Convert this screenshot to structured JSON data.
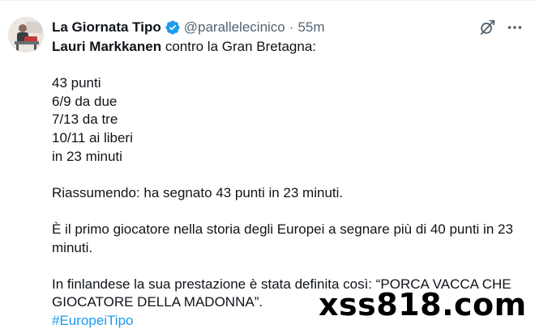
{
  "tweet": {
    "author_name": "La Giornata Tipo",
    "handle": "@parallelecinico",
    "separator": "·",
    "time": "55m",
    "verified_color": "#1d9bf0",
    "actions": [
      "grok-icon",
      "more-icon"
    ],
    "line1_bold": "Lauri Markkanen",
    "line1_rest": " contro la Gran Bretagna:",
    "stats": [
      "43 punti",
      "6/9 da due",
      "7/13 da tre",
      "10/11 ai liberi",
      "in 23 minuti"
    ],
    "summary": "Riassumendo: ha segnato 43 punti in 23 minuti.",
    "record_line1": "È il primo giocatore nella storia degli Europei a segnare più di 40 punti in 23",
    "record_line2": "minuti.",
    "finnish_line1": "In finlandese la sua prestazione è stata definita così: “PORCA VACCA CHE",
    "finnish_line2": "GIOCATORE DELLA MADONNA”.",
    "hashtag": "#EuropeiTipo"
  },
  "watermark": "xss818.com"
}
